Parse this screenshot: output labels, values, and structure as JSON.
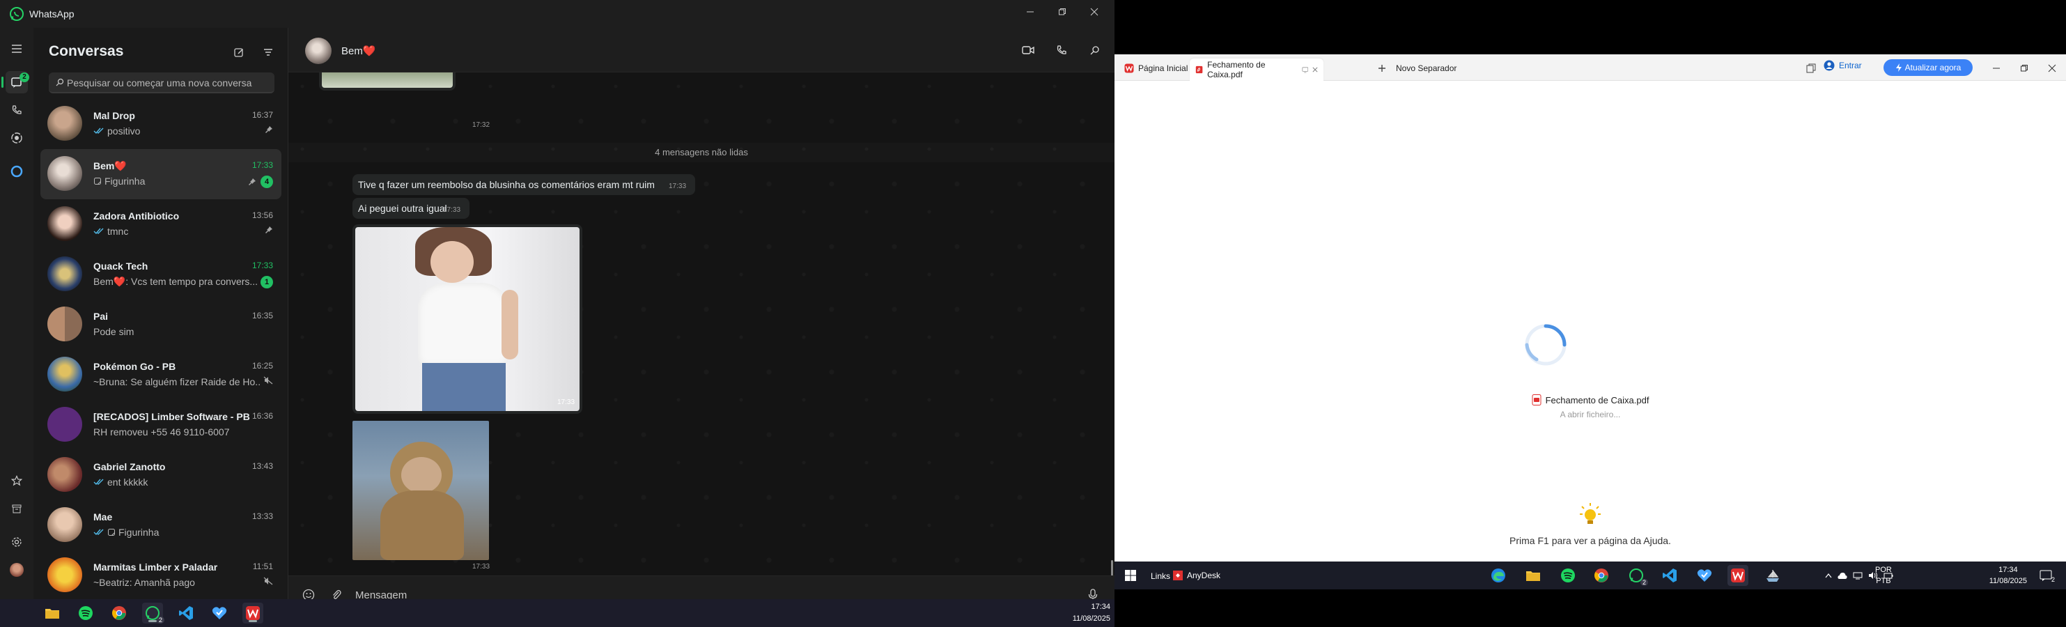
{
  "whatsapp": {
    "window_title": "WhatsApp",
    "sidebar": {
      "title": "Conversas",
      "search_placeholder": "Pesquisar ou começar uma nova conversa",
      "rail_badge": "2",
      "chats": [
        {
          "name": "Mal Drop",
          "time": "16:37",
          "preview": "positivo",
          "ticks": true,
          "pinned": true
        },
        {
          "name": "Bem❤️",
          "time": "17:33",
          "preview": "Figurinha",
          "pinned": true,
          "unread": "4",
          "time_green": true,
          "selected": true
        },
        {
          "name": "Zadora Antibiotico",
          "time": "13:56",
          "preview": "tmnc",
          "ticks": true,
          "pinned": true
        },
        {
          "name": "Quack Tech",
          "time": "17:33",
          "preview": "Bem❤️: Vcs tem tempo pra convers...",
          "unread": "1",
          "time_green": true
        },
        {
          "name": "Pai",
          "time": "16:35",
          "preview": "Pode sim"
        },
        {
          "name": "Pokémon Go - PB",
          "time": "16:25",
          "preview": "~Bruna: Se alguém fizer Raide de Ho...",
          "muted": true
        },
        {
          "name": "[RECADOS] Limber Software - PB",
          "time": "16:36",
          "preview": "RH removeu +55 46 9110-6007"
        },
        {
          "name": "Gabriel Zanotto",
          "time": "13:43",
          "preview": "ent kkkkk",
          "ticks": true
        },
        {
          "name": "Mae",
          "time": "13:33",
          "preview": "Figurinha",
          "ticks": true
        },
        {
          "name": "Marmitas Limber x Paladar",
          "time": "11:51",
          "preview": "~Beatriz: Amanhã pago",
          "muted": true
        }
      ]
    },
    "conversation": {
      "contact_name": "Bem❤️",
      "top_time": "17:32",
      "unread_divider": "4 mensagens não lidas",
      "messages": [
        {
          "text": "Tive q fazer um reembolso da blusinha os comentários eram mt ruim",
          "time": "17:33"
        },
        {
          "text": "Ai peguei outra igual",
          "time": "17:33"
        },
        {
          "image": "photo-woman-white-top",
          "time": "17:33"
        },
        {
          "image": "sticker-monkey",
          "time": "17:33"
        }
      ],
      "input_placeholder": "Mensagem"
    },
    "taskbar": {
      "time": "17:34",
      "date": "11/08/2025",
      "whatsapp_badge": "2"
    }
  },
  "browser": {
    "tabs": [
      {
        "label": "Página Inicial",
        "icon": "wps-icon"
      },
      {
        "label": "Fechamento de Caixa.pdf",
        "icon": "pdf-icon",
        "active": true
      },
      {
        "label": "Novo Separador",
        "icon": "plus-icon"
      }
    ],
    "signin_label": "Entrar",
    "update_label": "Atualizar agora",
    "loading_file": "Fechamento de Caixa.pdf",
    "loading_status": "A abrir ficheiro...",
    "help_text": "Prima F1 para ver a página da Ajuda."
  },
  "right_taskbar": {
    "links_label": "Links",
    "anydesk_label": "AnyDesk",
    "lang_1": "POR",
    "lang_2": "PTB",
    "time": "17:34",
    "date": "11/08/2025",
    "whatsapp_badge": "2",
    "notif_count": "2"
  },
  "colors": {
    "accent_green": "#21c063",
    "update_blue": "#3b82f6",
    "wps_red": "#e0302f"
  }
}
